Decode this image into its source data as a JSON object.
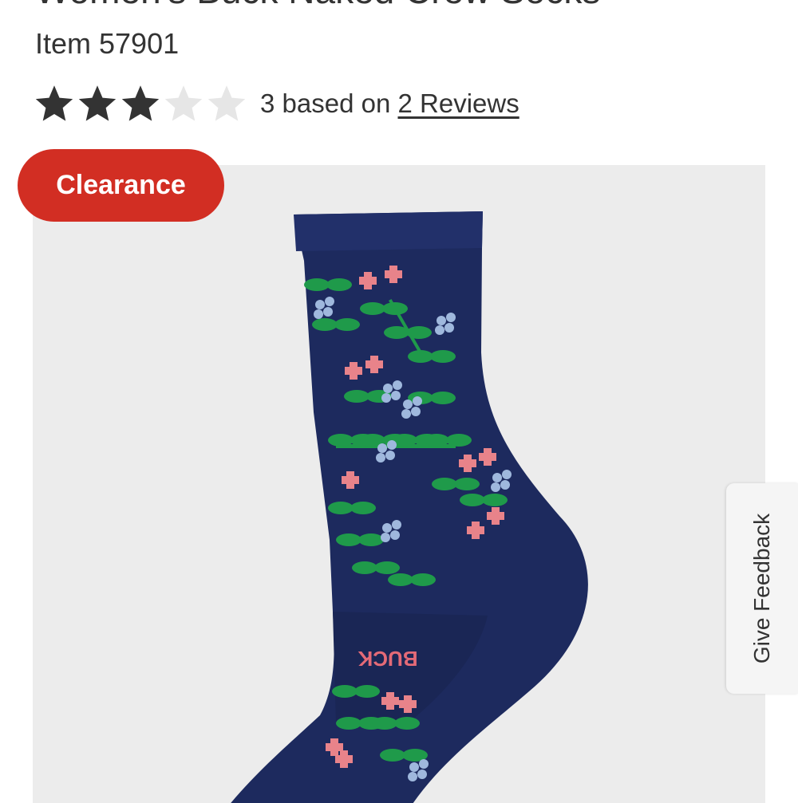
{
  "product": {
    "title": "Women's Buck Naked Crew Socks",
    "item_number": "Item 57901"
  },
  "rating": {
    "value": 3,
    "max": 5,
    "text": "3 based on",
    "reviews_link": "2 Reviews",
    "filled_color": "#333333",
    "empty_color": "#e6e6e6",
    "icon": "star-icon"
  },
  "badge": {
    "label": "Clearance",
    "color": "#d22e23"
  },
  "feedback": {
    "label": "Give Feedback"
  },
  "image": {
    "background": "#ececec",
    "sock_color": "#1d2a5e",
    "sock_text": "BUCK"
  }
}
